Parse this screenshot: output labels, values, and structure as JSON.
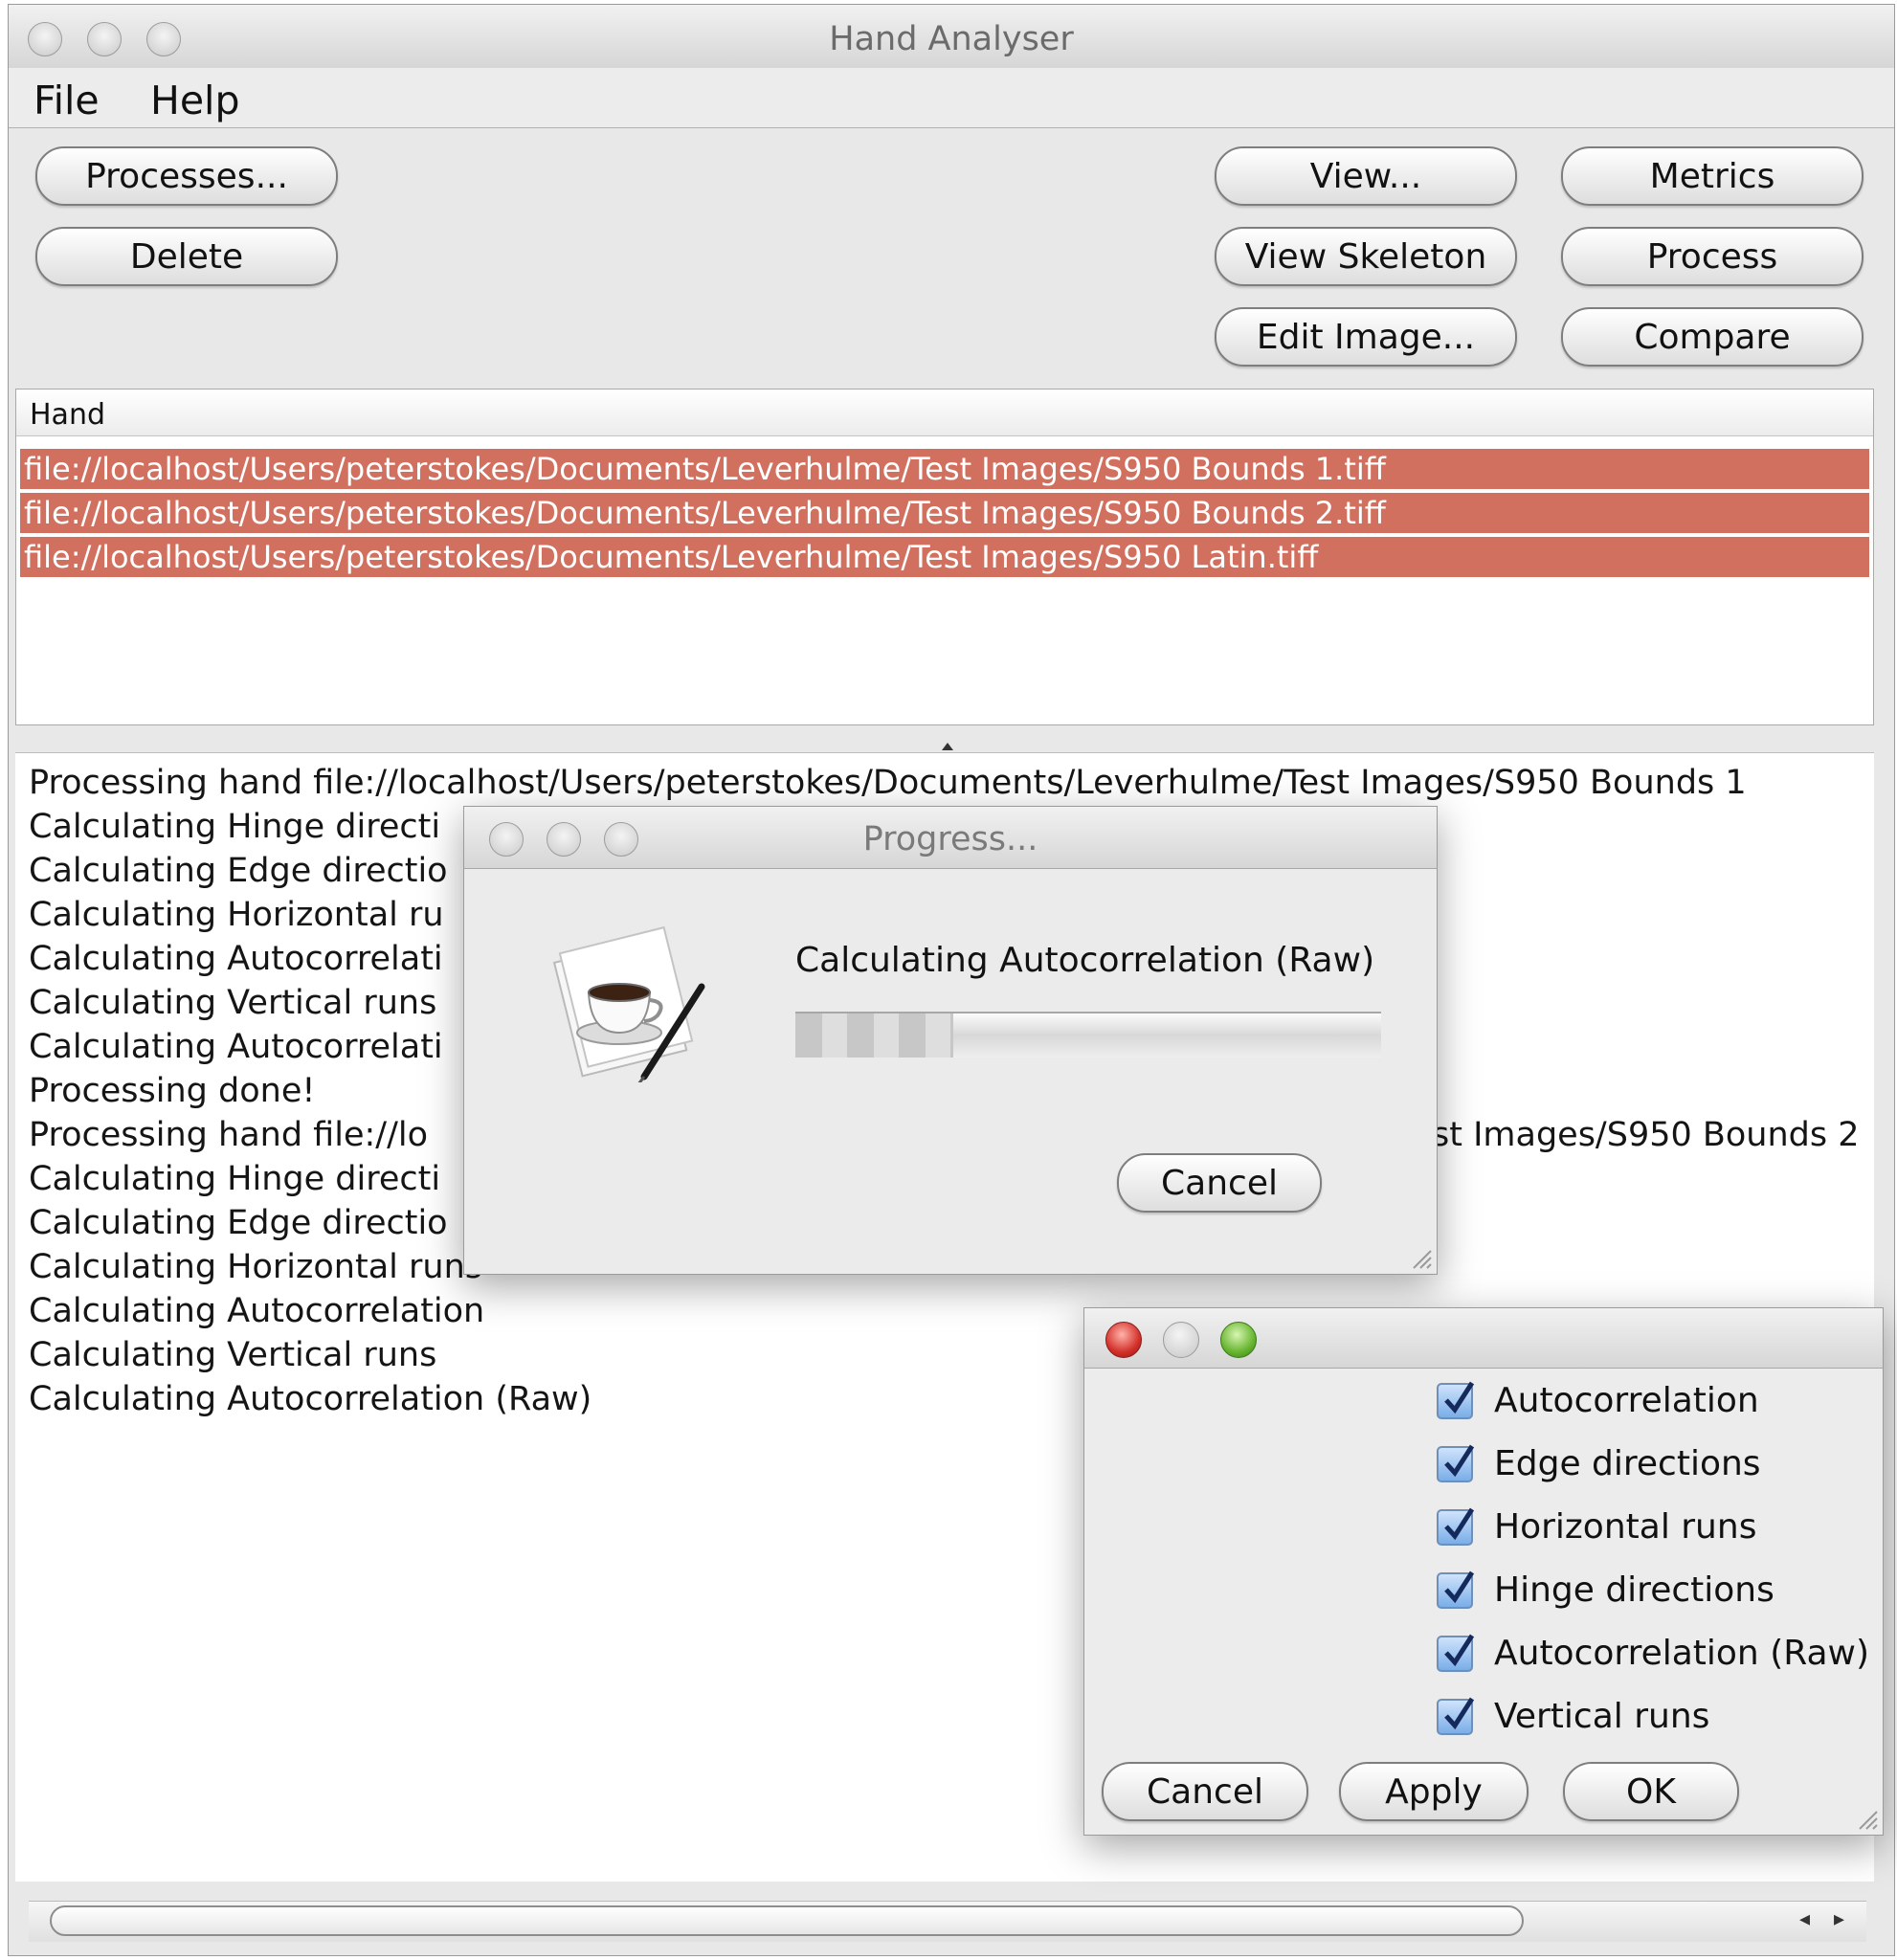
{
  "window": {
    "title": "Hand Analyser"
  },
  "menu": {
    "file": "File",
    "help": "Help"
  },
  "toolbar": {
    "processes": "Processes...",
    "delete": "Delete",
    "view": "View...",
    "view_skeleton": "View Skeleton",
    "edit_image": "Edit Image...",
    "metrics": "Metrics",
    "process": "Process",
    "compare": "Compare"
  },
  "hand_list": {
    "header": "Hand",
    "rows": [
      "file://localhost/Users/peterstokes/Documents/Leverhulme/Test Images/S950 Bounds 1.tiff",
      "file://localhost/Users/peterstokes/Documents/Leverhulme/Test Images/S950 Bounds 2.tiff",
      "file://localhost/Users/peterstokes/Documents/Leverhulme/Test Images/S950 Latin.tiff"
    ],
    "row_color": "#d2705f"
  },
  "log": {
    "lines": [
      "Processing hand file://localhost/Users/peterstokes/Documents/Leverhulme/Test Images/S950 Bounds 1",
      "Calculating Hinge directi",
      "Calculating Edge directio",
      "Calculating Horizontal ru",
      "Calculating Autocorrelati",
      "Calculating Vertical runs",
      "Calculating Autocorrelati",
      "Processing done!",
      "Processing hand file://lo",
      "Calculating Hinge directi",
      "Calculating Edge directio",
      "Calculating Horizontal runs",
      "Calculating Autocorrelation",
      "Calculating Vertical runs",
      "Calculating Autocorrelation (Raw)"
    ],
    "partial_right": "st Images/S950 Bounds 2"
  },
  "progress_dialog": {
    "title": "Progress...",
    "message": "Calculating Autocorrelation (Raw)",
    "progress_fraction": 0.27,
    "cancel": "Cancel"
  },
  "options_dialog": {
    "checks": [
      {
        "label": "Autocorrelation",
        "checked": true
      },
      {
        "label": "Edge directions",
        "checked": true
      },
      {
        "label": "Horizontal runs",
        "checked": true
      },
      {
        "label": "Hinge directions",
        "checked": true
      },
      {
        "label": "Autocorrelation (Raw)",
        "checked": true
      },
      {
        "label": "Vertical runs",
        "checked": true
      }
    ],
    "cancel": "Cancel",
    "apply": "Apply",
    "ok": "OK"
  },
  "icons": {
    "app": "java-coffee-cup-icon",
    "scroll_left": "◂",
    "scroll_right": "▸"
  }
}
